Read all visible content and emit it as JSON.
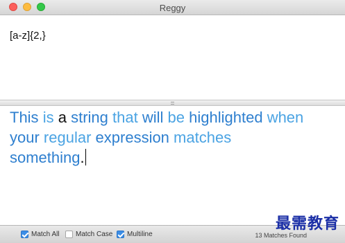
{
  "window": {
    "title": "Reggy"
  },
  "regex": {
    "value": "[a-z]{2,}"
  },
  "sample_text": {
    "line1": [
      {
        "text": "This",
        "style": "hl-a"
      },
      {
        "text": " "
      },
      {
        "text": "is",
        "style": "hl-b"
      },
      {
        "text": " "
      },
      {
        "text": "a",
        "style": "plain"
      },
      {
        "text": " "
      },
      {
        "text": "string",
        "style": "hl-a"
      },
      {
        "text": " "
      },
      {
        "text": "that",
        "style": "hl-b"
      },
      {
        "text": " "
      },
      {
        "text": "will",
        "style": "hl-a"
      },
      {
        "text": " "
      },
      {
        "text": "be",
        "style": "hl-b"
      },
      {
        "text": " "
      },
      {
        "text": "highlighted",
        "style": "hl-a"
      },
      {
        "text": " "
      },
      {
        "text": "when",
        "style": "hl-b"
      }
    ],
    "line2": [
      {
        "text": "your",
        "style": "hl-a"
      },
      {
        "text": " "
      },
      {
        "text": "regular",
        "style": "hl-b"
      },
      {
        "text": " "
      },
      {
        "text": "expression",
        "style": "hl-a"
      },
      {
        "text": " "
      },
      {
        "text": "matches",
        "style": "hl-b"
      }
    ],
    "line3": [
      {
        "text": "something",
        "style": "hl-a"
      },
      {
        "text": ".",
        "style": "plain"
      }
    ]
  },
  "options": {
    "match_all": {
      "label": "Match All",
      "checked": true
    },
    "match_case": {
      "label": "Match Case",
      "checked": false
    },
    "multiline": {
      "label": "Multiline",
      "checked": true
    }
  },
  "status": {
    "matches": "13 Matches Found"
  },
  "watermark": "最需教育",
  "colors": {
    "match_dark": "#2e7fcf",
    "match_light": "#4aa3e3",
    "checkbox_on": "#3b8de6"
  }
}
